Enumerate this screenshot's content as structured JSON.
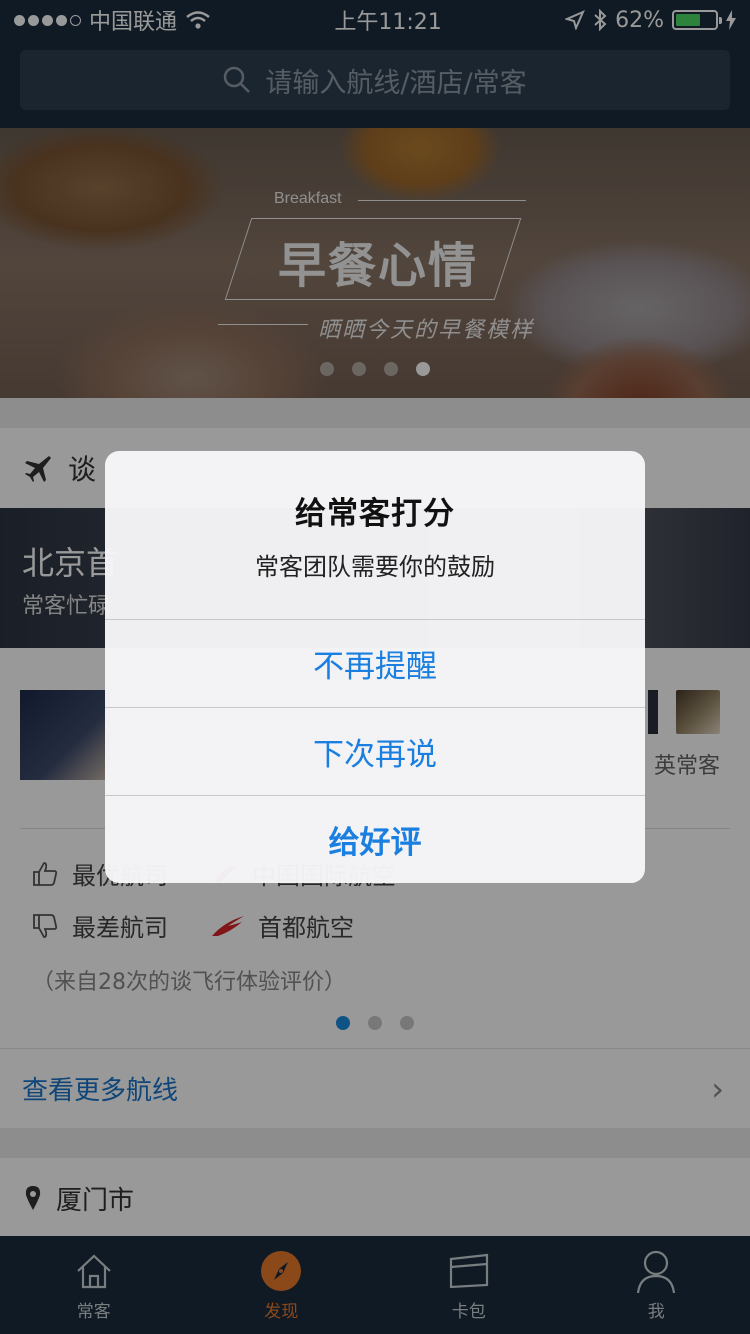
{
  "status_bar": {
    "carrier": "中国联通",
    "time": "上午11:21",
    "battery": "62%",
    "battery_level": 0.62
  },
  "search": {
    "placeholder": "请输入航线/酒店/常客"
  },
  "banner": {
    "subtitle": "Breakfast",
    "title": "早餐心情",
    "tagline": "晒晒今天的早餐模样",
    "slide_count": 4,
    "active_slide": 4
  },
  "talk_card": {
    "header": "谈",
    "route_title": "北京首",
    "route_subtitle": "常客忙碌",
    "right_thumb_label": "英常客",
    "best_label": "最优航司",
    "best_value": "中国国际航空",
    "worst_label": "最差航司",
    "worst_value": "首都航空",
    "review_note": "（来自28次的谈飞行体验评价）",
    "page_count": 3,
    "active_page": 1,
    "more_routes": "查看更多航线"
  },
  "city": {
    "name": "厦门市"
  },
  "tabbar": {
    "tabs": [
      {
        "label": "常客",
        "icon": "house-icon",
        "active": false
      },
      {
        "label": "发现",
        "icon": "compass-icon",
        "active": true
      },
      {
        "label": "卡包",
        "icon": "card-wallet-icon",
        "active": false
      },
      {
        "label": "我",
        "icon": "person-icon",
        "active": false
      }
    ]
  },
  "alert": {
    "title": "给常客打分",
    "message": "常客团队需要你的鼓励",
    "buttons": {
      "no_remind": "不再提醒",
      "later": "下次再说",
      "rate": "给好评"
    }
  },
  "colors": {
    "header_bg": "#1b2c3c",
    "accent_blue": "#1a7fe0",
    "tab_active": "#e8782b"
  }
}
